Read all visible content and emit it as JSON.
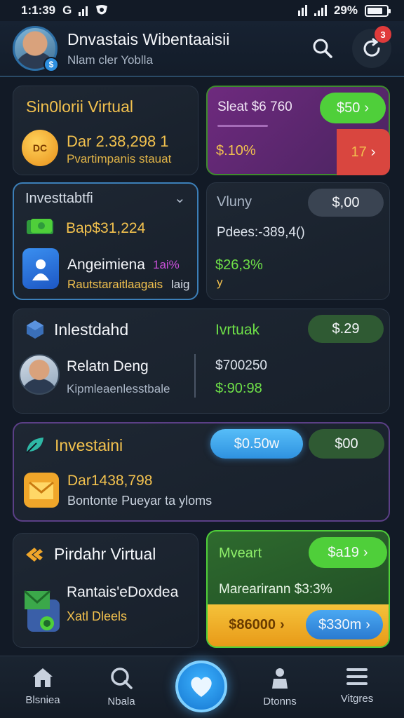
{
  "status": {
    "time": "1:1:39",
    "battery": "29%"
  },
  "header": {
    "title": "Dnvastais Wibentaaisii",
    "subtitle": "Nlam cler Yoblla",
    "notification_count": "3"
  },
  "card1": {
    "title": "Sin0lorii Virtual",
    "amount": "Dar 2.38,298 1",
    "subtitle": "Pvartimpanis stauat",
    "coin_label": "DC"
  },
  "card2": {
    "label": "Sleat $6 760",
    "pill_top": "$50",
    "value": "$.10%",
    "pill_bottom": "17"
  },
  "card3": {
    "title": "Investtabtfi",
    "amount": "Bap$31,224",
    "row_title": "Angeimiena",
    "row_percent": "1ai%",
    "row_sub": "Rautstaraitlaagais",
    "row_extra": "laig"
  },
  "card4": {
    "label": "Vluny",
    "pill": "$,00",
    "line": "Pdees:-389,4()",
    "value": "$26,3%",
    "note": "y"
  },
  "card5": {
    "title": "Inlestdahd",
    "right_label": "Ivrtuak",
    "pill": "$.29",
    "person_name": "Relatn Deng",
    "person_sub": "Kipmleaenlesstbale",
    "value_top": "$700250",
    "value_bottom": "$:90:98"
  },
  "card6": {
    "title": "Investaini",
    "pill_blue": "$0.50w",
    "pill_green": "$00",
    "amount": "Dar1438,798",
    "subtitle": "Bontonte Pueyar ta yloms"
  },
  "card7": {
    "title": "Pirdahr Virtual",
    "line1": "Rantais'eDoxdea",
    "line2": "Xatl Dleels"
  },
  "card8": {
    "label": "Mveart",
    "pill": "$a19",
    "line": "Marearirann $3:3%",
    "pill_left": "$86000",
    "pill_right": "$330m"
  },
  "nav": {
    "items": [
      {
        "label": "Blsniea"
      },
      {
        "label": "Nbala"
      },
      {
        "label": "Dtonns"
      },
      {
        "label": "Vitgres"
      }
    ]
  },
  "colors": {
    "background": "#121a26",
    "accent_green": "#4fcf3a",
    "accent_blue": "#3aa6f0",
    "accent_purple": "#7a2f86",
    "accent_red": "#d9463f",
    "accent_gold": "#f0b42a"
  }
}
